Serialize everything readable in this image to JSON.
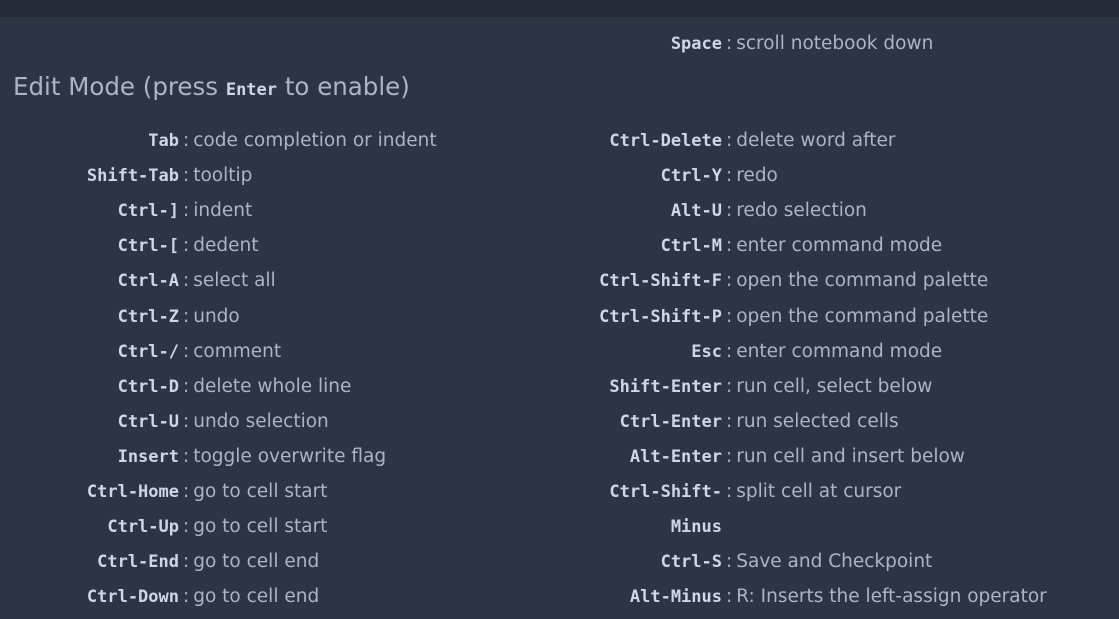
{
  "top_partial": {
    "key": "S",
    "desc": "scroll"
  },
  "command_tail": [
    {
      "key": "Space",
      "desc": "scroll notebook down"
    }
  ],
  "edit_mode": {
    "title_prefix": "Edit Mode (press",
    "title_key": "Enter",
    "title_suffix": "to enable)",
    "left": [
      {
        "key": "Tab",
        "desc": "code completion or indent"
      },
      {
        "key": "Shift-Tab",
        "desc": "tooltip"
      },
      {
        "key": "Ctrl-]",
        "desc": "indent"
      },
      {
        "key": "Ctrl-[",
        "desc": "dedent"
      },
      {
        "key": "Ctrl-A",
        "desc": "select all"
      },
      {
        "key": "Ctrl-Z",
        "desc": "undo"
      },
      {
        "key": "Ctrl-/",
        "desc": "comment"
      },
      {
        "key": "Ctrl-D",
        "desc": "delete whole line"
      },
      {
        "key": "Ctrl-U",
        "desc": "undo selection"
      },
      {
        "key": "Insert",
        "desc": "toggle overwrite flag"
      },
      {
        "key": "Ctrl-Home",
        "desc": "go to cell start"
      },
      {
        "key": "Ctrl-Up",
        "desc": "go to cell start"
      },
      {
        "key": "Ctrl-End",
        "desc": "go to cell end"
      },
      {
        "key": "Ctrl-Down",
        "desc": "go to cell end"
      }
    ],
    "right": [
      {
        "key": "Ctrl-Delete",
        "desc": "delete word after"
      },
      {
        "key": "Ctrl-Y",
        "desc": "redo"
      },
      {
        "key": "Alt-U",
        "desc": "redo selection"
      },
      {
        "key": "Ctrl-M",
        "desc": "enter command mode"
      },
      {
        "key": "Ctrl-Shift-F",
        "desc": "open the command palette"
      },
      {
        "key": "Ctrl-Shift-P",
        "desc": "open the command palette"
      },
      {
        "key": "Esc",
        "desc": "enter command mode"
      },
      {
        "key": "Shift-Enter",
        "desc": "run cell, select below"
      },
      {
        "key": "Ctrl-Enter",
        "desc": "run selected cells"
      },
      {
        "key": "Alt-Enter",
        "desc": "run cell and insert below"
      },
      {
        "key": "Ctrl-Shift-",
        "key2": "Minus",
        "desc": "split cell at cursor"
      },
      {
        "key": "Ctrl-S",
        "desc": "Save and Checkpoint"
      },
      {
        "key": "Alt-Minus",
        "desc": "R: Inserts the left-assign operator"
      }
    ]
  },
  "colors": {
    "background": "#2b3544",
    "key": "#cdd7e6",
    "text": "#a9b6c8"
  }
}
